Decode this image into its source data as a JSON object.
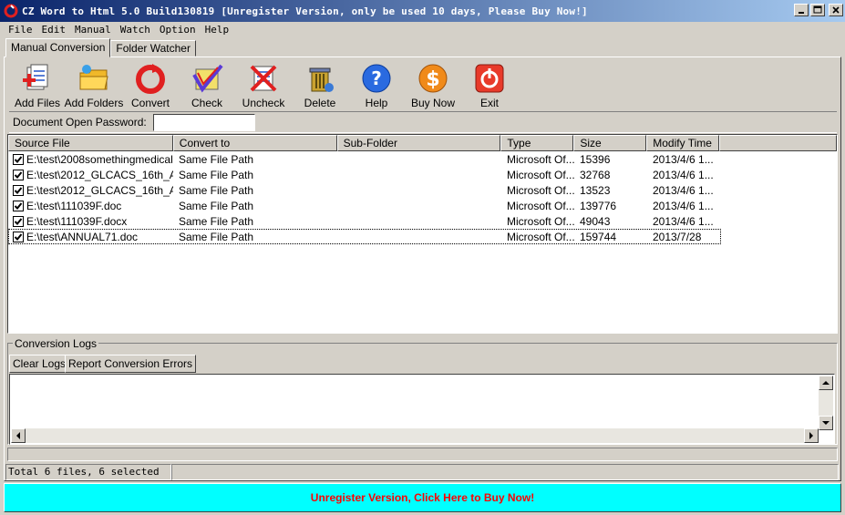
{
  "window": {
    "title": "CZ Word to Html 5.0 Build130819 [Unregister Version, only be used 10 days, Please Buy Now!]"
  },
  "menu": [
    "File",
    "Edit",
    "Manual",
    "Watch",
    "Option",
    "Help"
  ],
  "tabs": [
    "Manual Conversion",
    "Folder Watcher"
  ],
  "toolbar": {
    "add_files": "Add Files",
    "add_folders": "Add Folders",
    "convert": "Convert",
    "check": "Check",
    "uncheck": "Uncheck",
    "delete": "Delete",
    "help": "Help",
    "buy_now": "Buy Now",
    "exit": "Exit"
  },
  "password": {
    "label": "Document Open Password:",
    "value": ""
  },
  "table": {
    "columns": [
      "Source File",
      "Convert to",
      "Sub-Folder",
      "Type",
      "Size",
      "Modify Time"
    ],
    "rows": [
      {
        "source": "E:\\test\\2008somethingmedical....",
        "convert_to": "Same File Path",
        "sub_folder": "",
        "type": "Microsoft Of...",
        "size": "15396",
        "modified": "2013/4/6  1...",
        "checked": true
      },
      {
        "source": "E:\\test\\2012_GLCACS_16th_A...",
        "convert_to": "Same File Path",
        "sub_folder": "",
        "type": "Microsoft Of...",
        "size": "32768",
        "modified": "2013/4/6  1...",
        "checked": true
      },
      {
        "source": "E:\\test\\2012_GLCACS_16th_A...",
        "convert_to": "Same File Path",
        "sub_folder": "",
        "type": "Microsoft Of...",
        "size": "13523",
        "modified": "2013/4/6  1...",
        "checked": true
      },
      {
        "source": "E:\\test\\111039F.doc",
        "convert_to": "Same File Path",
        "sub_folder": "",
        "type": "Microsoft Of...",
        "size": "139776",
        "modified": "2013/4/6  1...",
        "checked": true
      },
      {
        "source": "E:\\test\\111039F.docx",
        "convert_to": "Same File Path",
        "sub_folder": "",
        "type": "Microsoft Of...",
        "size": "49043",
        "modified": "2013/4/6  1...",
        "checked": true
      },
      {
        "source": "E:\\test\\ANNUAL71.doc",
        "convert_to": "Same File Path",
        "sub_folder": "",
        "type": "Microsoft Of...",
        "size": "159744",
        "modified": "2013/7/28",
        "checked": true
      }
    ]
  },
  "logs": {
    "legend": "Conversion Logs",
    "clear_label": "Clear Logs",
    "report_label": "Report Conversion Errors"
  },
  "status": {
    "summary": "Total 6 files, 6 selected"
  },
  "buy_banner": "Unregister Version, Click Here to Buy Now!"
}
